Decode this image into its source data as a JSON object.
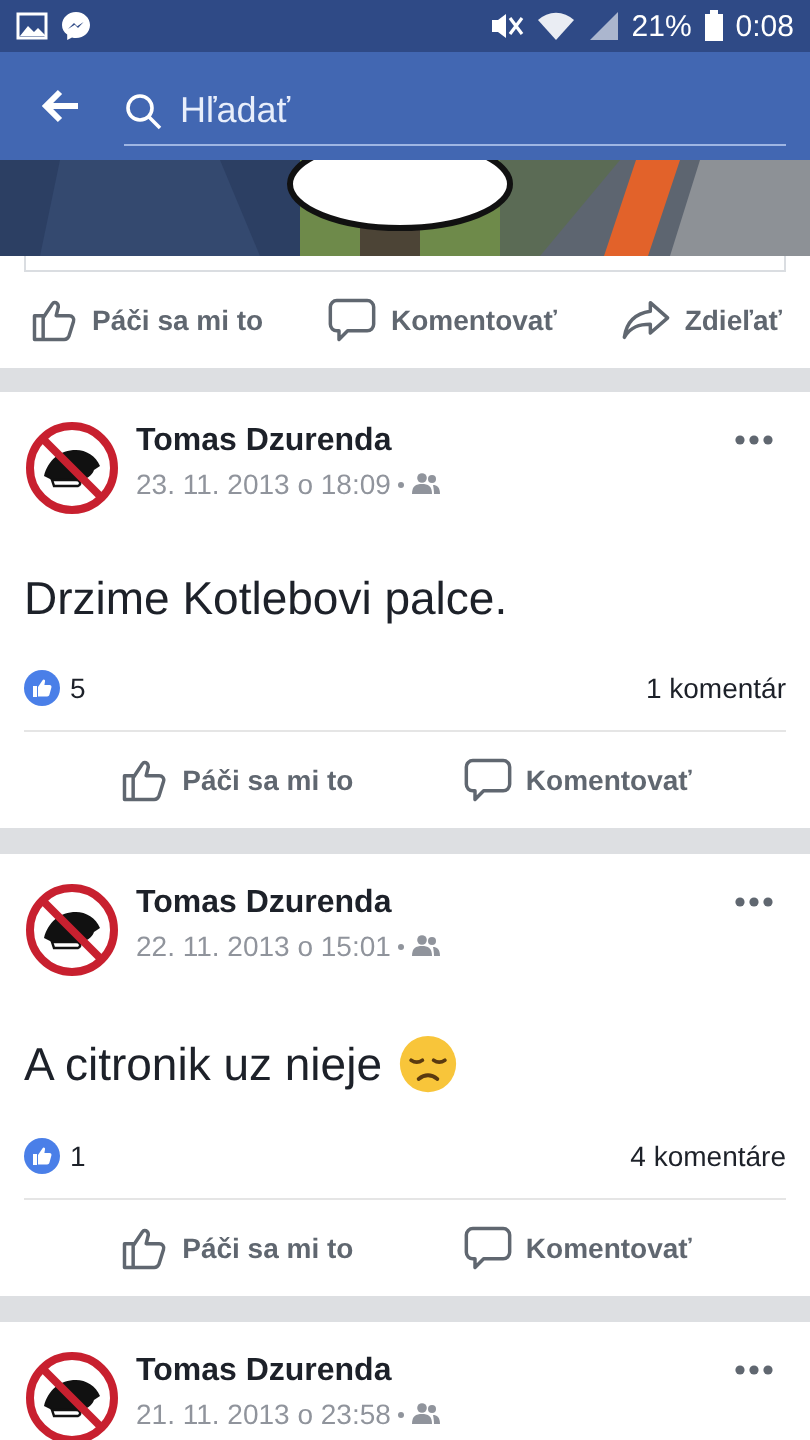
{
  "status_bar": {
    "battery": "21%",
    "time": "0:08"
  },
  "header": {
    "search": {
      "placeholder": "Hľadať"
    }
  },
  "shared_post": {
    "actions": [
      {
        "kind": "like",
        "label": "Páči sa mi to"
      },
      {
        "kind": "comment",
        "label": "Komentovať"
      },
      {
        "kind": "share",
        "label": "Zdieľať"
      }
    ]
  },
  "posts": [
    {
      "kind": "text",
      "author": "Tomas Dzurenda",
      "date": "23. 11. 2013 o 18:09",
      "text": "Drzime Kotlebovi palce.",
      "likes": "5",
      "comments": "1 komentár",
      "actions": [
        {
          "kind": "like",
          "label": "Páči sa mi to"
        },
        {
          "kind": "comment",
          "label": "Komentovať"
        }
      ]
    },
    {
      "kind": "text_with_emoji",
      "author": "Tomas Dzurenda",
      "date": "22. 11. 2013 o 15:01",
      "text": "A citronik uz nieje",
      "likes": "1",
      "comments": "4 komentáre",
      "actions": [
        {
          "kind": "like",
          "label": "Páči sa mi to"
        },
        {
          "kind": "comment",
          "label": "Komentovať"
        }
      ]
    },
    {
      "kind": "header_only",
      "author": "Tomas Dzurenda",
      "date": "21. 11. 2013 o 23:58"
    }
  ]
}
